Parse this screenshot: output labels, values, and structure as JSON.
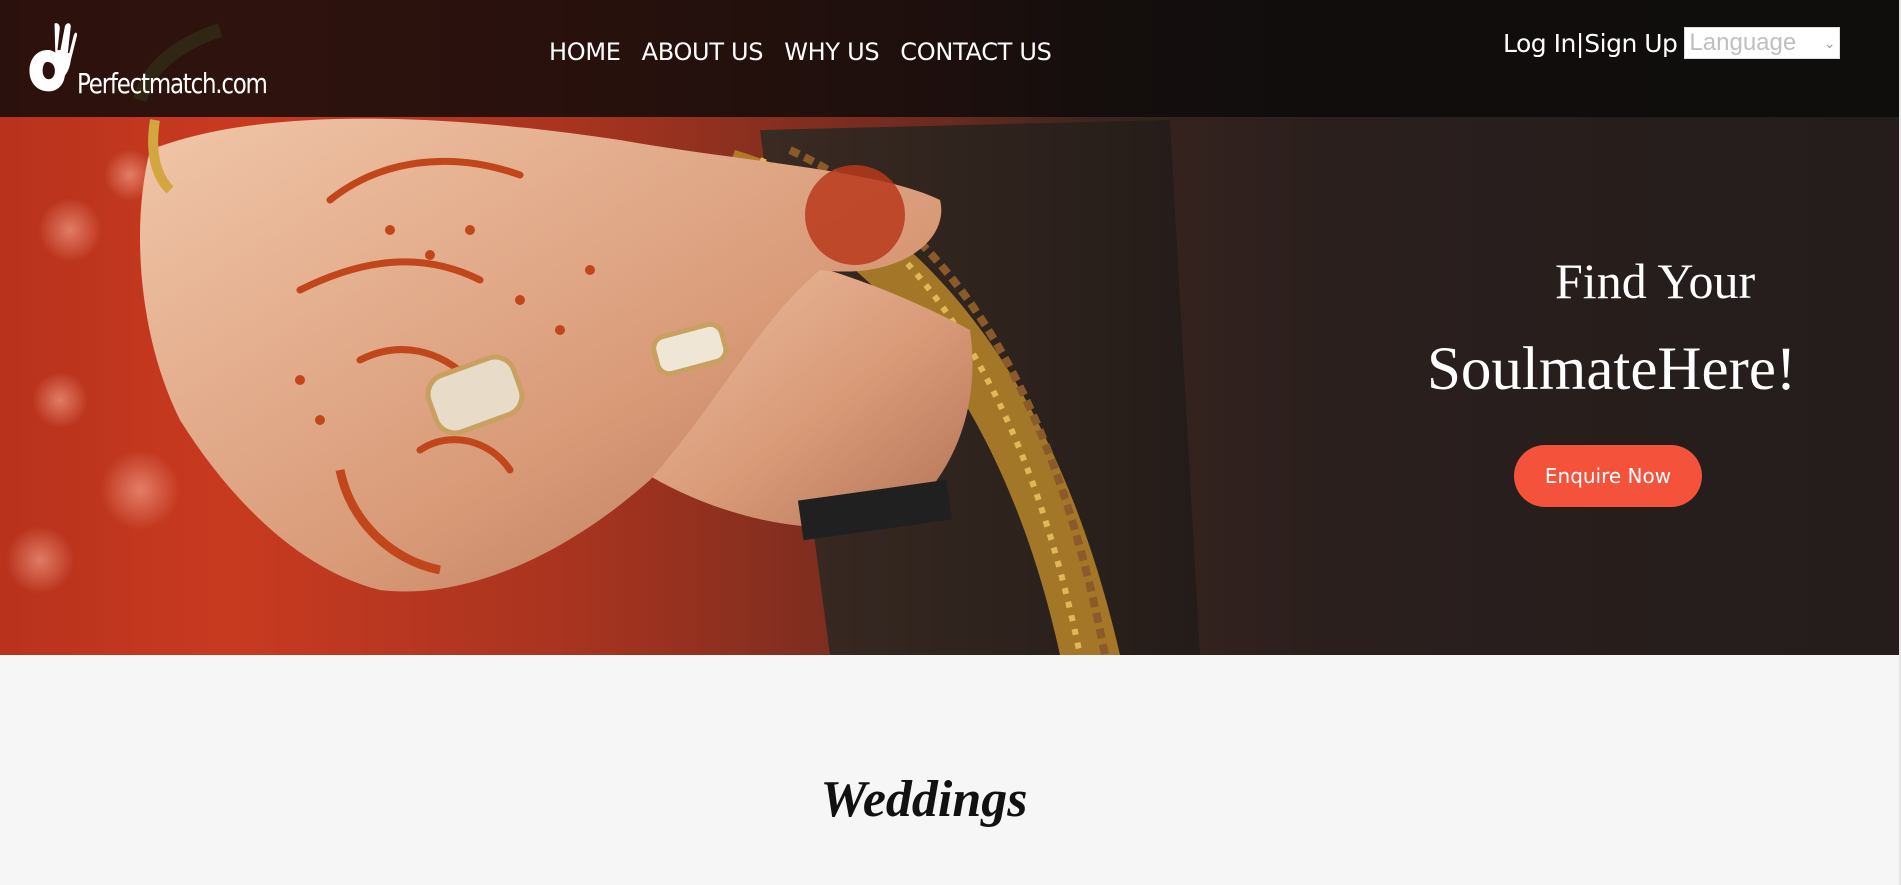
{
  "header": {
    "logo_text": "Perfectmatch.com",
    "nav": [
      "HOME",
      "ABOUT US",
      "WHY US",
      "CONTACT US"
    ],
    "login": "Log In",
    "separator": "|",
    "signup": "Sign Up",
    "language_placeholder": "Language"
  },
  "hero": {
    "line1": "Find Your",
    "line2": "SoulmateHere!",
    "cta": "Enquire Now"
  },
  "section": {
    "title": "Weddings"
  },
  "colors": {
    "accent": "#f4523b",
    "header_bg": "#0c0a0a",
    "page_bg": "#f6f6f6"
  },
  "icons": {
    "logo": "ok-hand-icon",
    "language_dropdown": "chevron-down-icon"
  }
}
